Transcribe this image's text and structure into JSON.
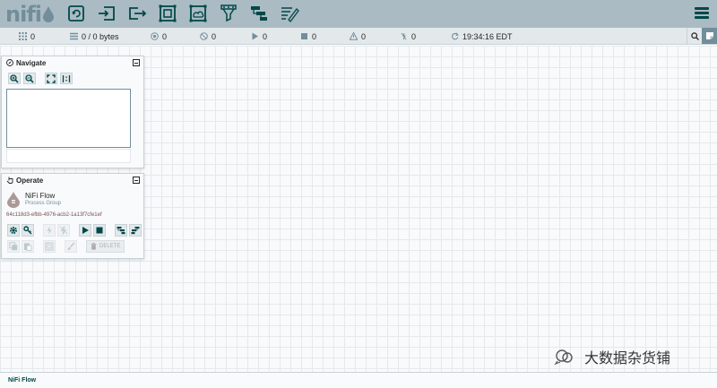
{
  "app": {
    "logo_text": "nifi"
  },
  "toolbar": {
    "tools": [
      "processor-icon",
      "input-port-icon",
      "output-port-icon",
      "process-group-icon",
      "remote-process-group-icon",
      "funnel-icon",
      "template-icon",
      "label-icon"
    ],
    "menu": "hamburger-menu-icon"
  },
  "status": {
    "active_threads": "0",
    "queued": "0 / 0 bytes",
    "transmitting": "0",
    "not_transmitting": "0",
    "running": "0",
    "stopped": "0",
    "invalid": "0",
    "disabled": "0",
    "last_refreshed": "19:34:16 EDT"
  },
  "navigate": {
    "title": "Navigate"
  },
  "operate": {
    "title": "Operate",
    "name": "NiFi Flow",
    "type": "Process Group",
    "id": "64c118d3-efbb-4976-acb2-1a13f7cfe1ef",
    "delete_label": "DELETE"
  },
  "breadcrumb": "NiFi Flow",
  "watermark": "大数据杂货铺",
  "colors": {
    "toolbar": "#aabbc3",
    "accent": "#004849",
    "statusbar": "#e3e8eb"
  }
}
